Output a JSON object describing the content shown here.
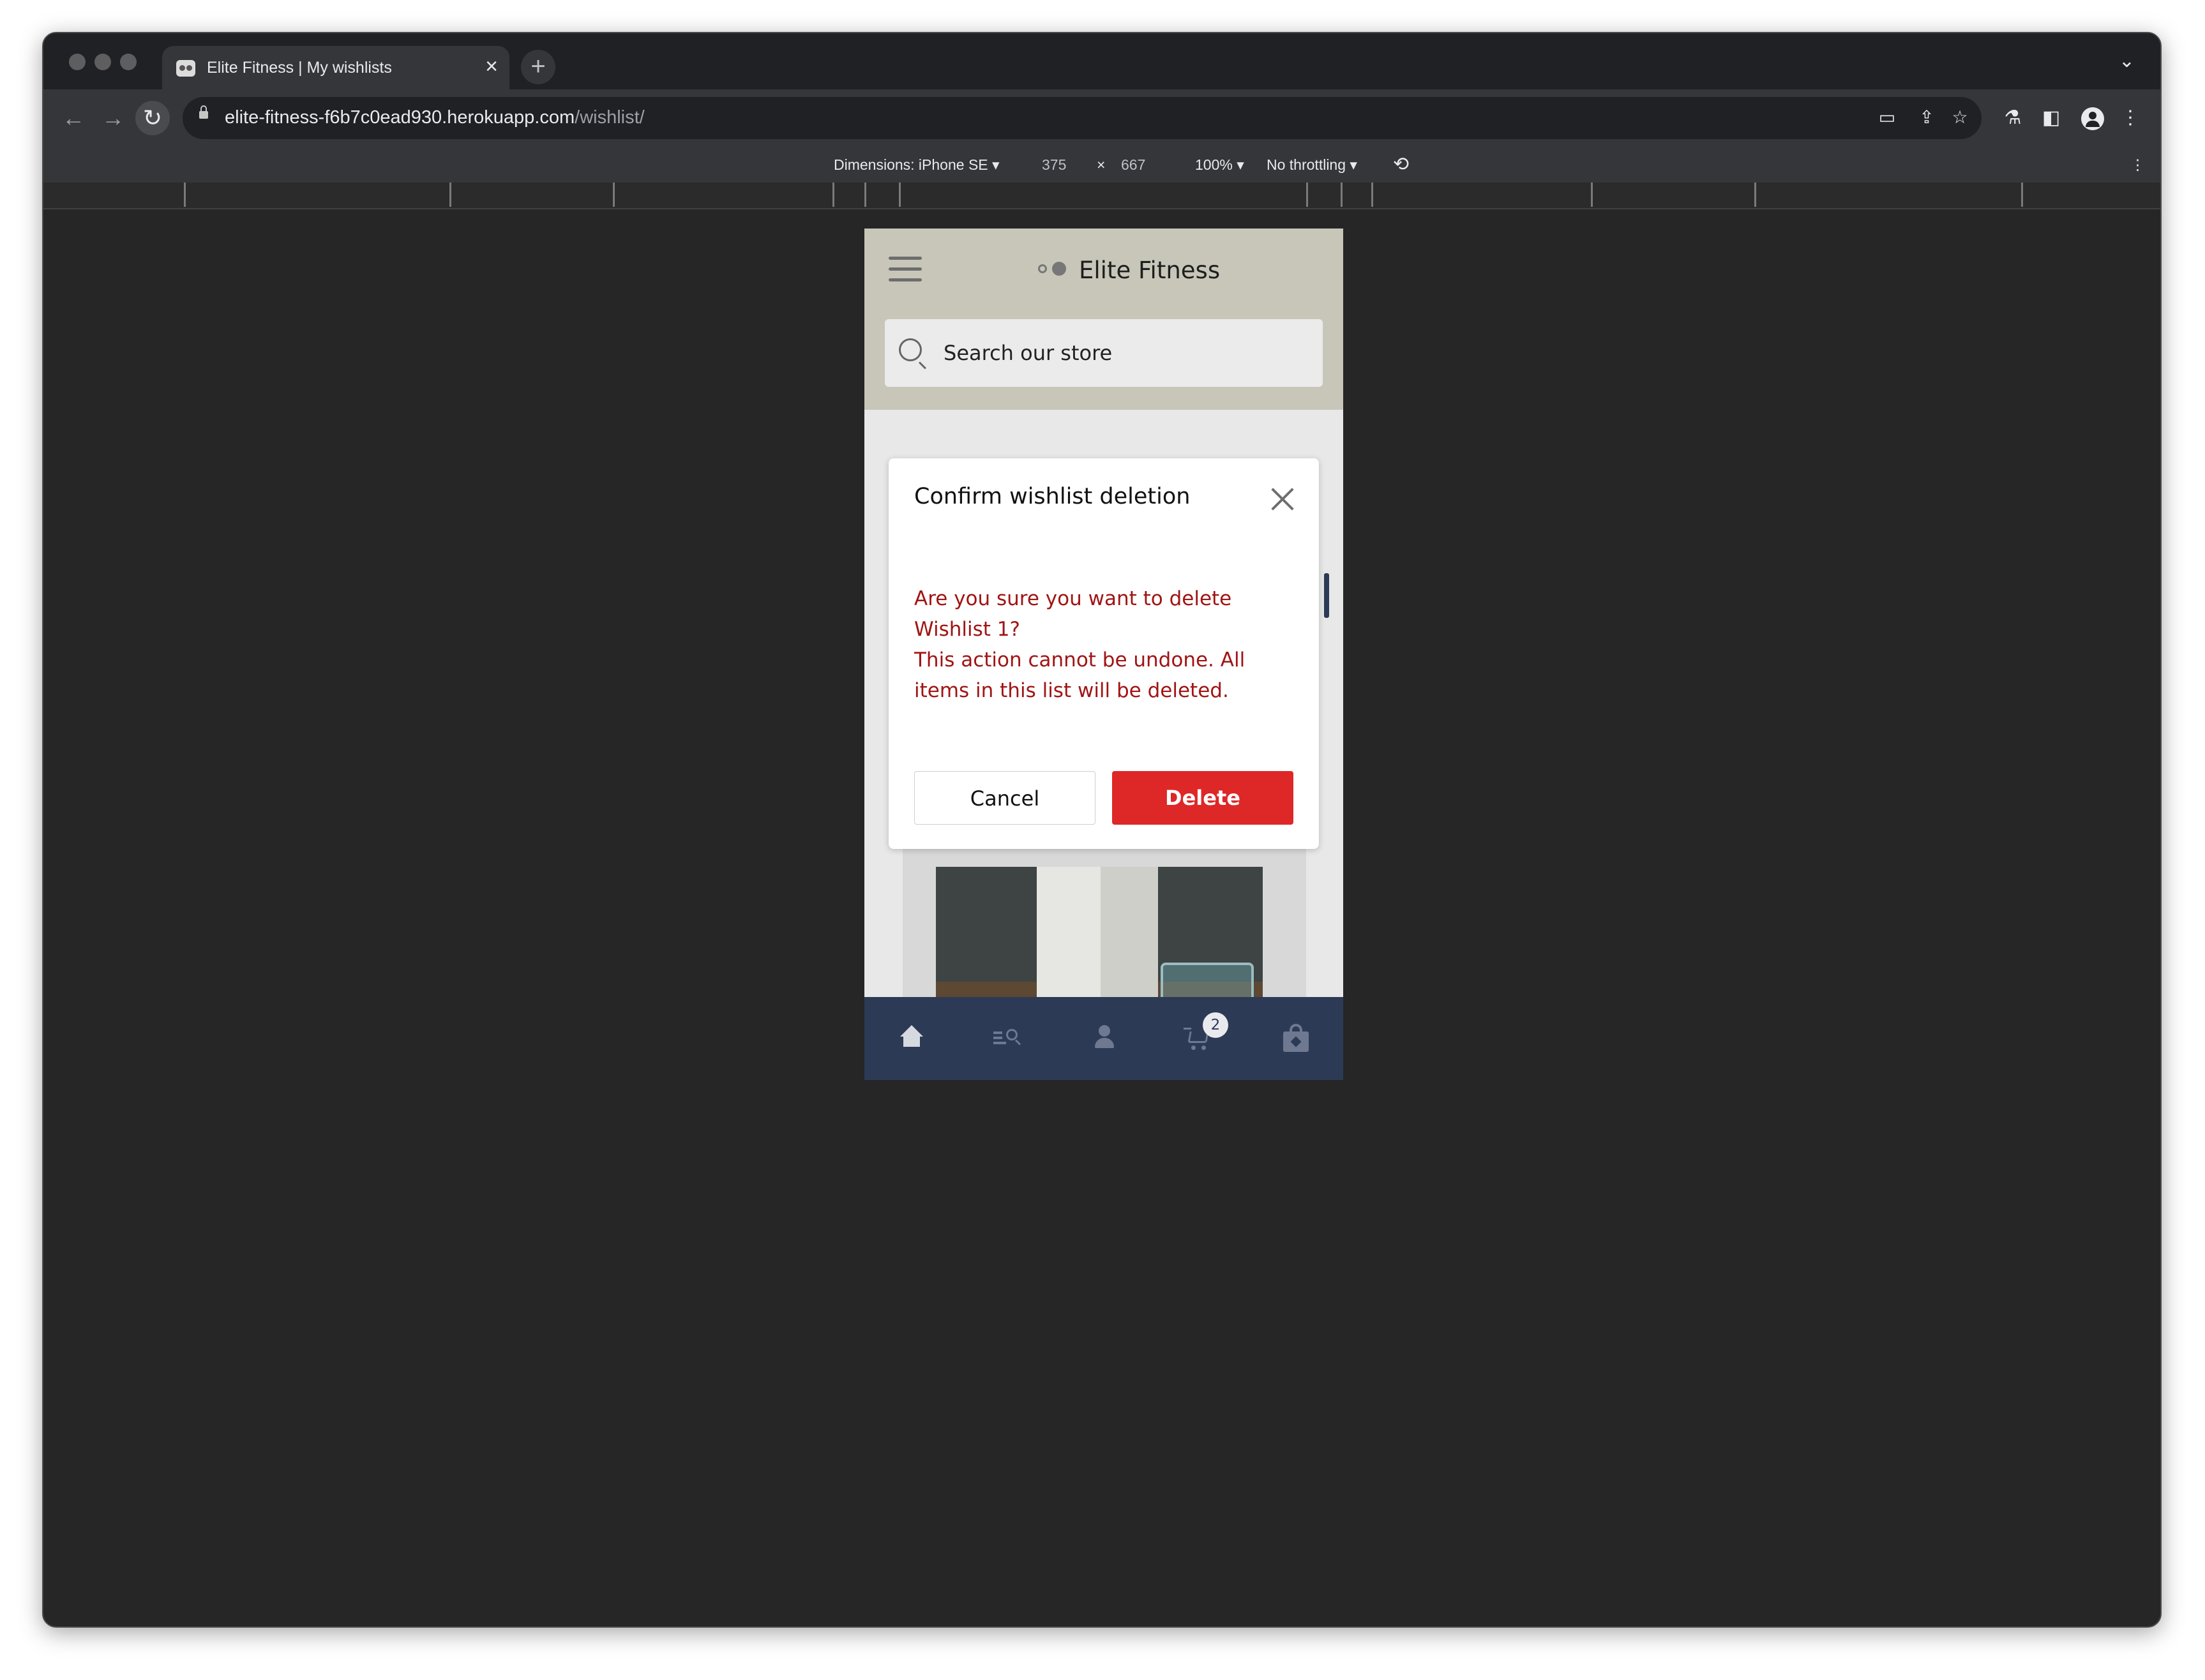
{
  "browser": {
    "tab_title": "Elite Fitness | My wishlists",
    "tab_close": "×",
    "new_tab": "+",
    "tab_list": "⌄",
    "url_host": "elite-fitness-f6b7c0ead930.herokuapp.com",
    "url_path": "/wishlist/",
    "nav": {
      "back": "←",
      "forward": "→",
      "reload": "↻"
    },
    "menu": "⋮"
  },
  "devtools": {
    "dimensions_label": "Dimensions: iPhone SE",
    "width": "375",
    "times": "×",
    "height": "667",
    "zoom": "100%",
    "throttling": "No throttling",
    "caret": "▾",
    "menu": "⋮"
  },
  "site": {
    "brand": "Elite Fitness",
    "search_placeholder": "Search our store"
  },
  "modal": {
    "title": "Confirm wishlist deletion",
    "body_line1": "Are you sure you want to delete Wishlist 1?",
    "body_line2": "This action cannot be undone. All items in this list will be deleted.",
    "cancel_label": "Cancel",
    "delete_label": "Delete",
    "body_color": "#a01414",
    "delete_color": "#de2727"
  },
  "bottom_nav": {
    "cart_count": "2",
    "items": [
      "home-icon",
      "search-list-icon",
      "user-icon",
      "cart-icon",
      "shopping-bag-icon"
    ]
  },
  "colors": {
    "header_bg": "#c7c6b9",
    "bottom_nav_bg": "#2c3a55"
  }
}
